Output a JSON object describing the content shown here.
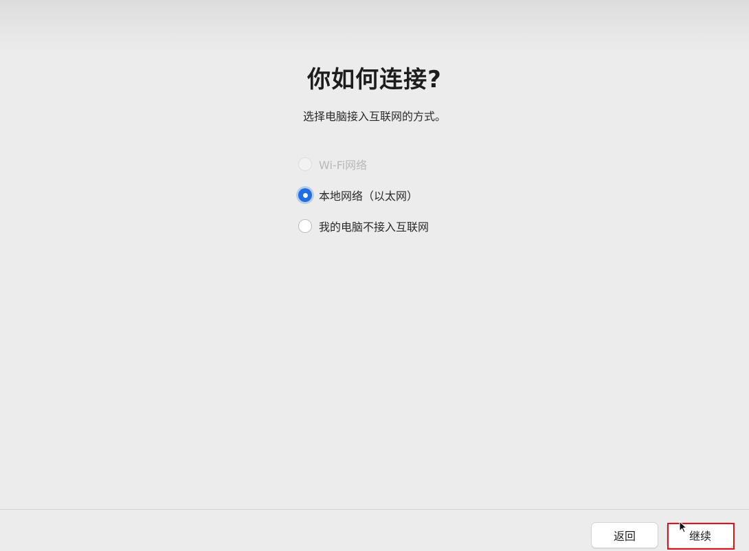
{
  "header": {
    "title": "你如何连接?",
    "subtitle": "选择电脑接入互联网的方式。"
  },
  "options": [
    {
      "label": "Wi-Fi网络",
      "state": "disabled"
    },
    {
      "label": "本地网络（以太网）",
      "state": "checked"
    },
    {
      "label": "我的电脑不接入互联网",
      "state": "unchecked"
    }
  ],
  "footer": {
    "back_label": "返回",
    "continue_label": "继续"
  },
  "colors": {
    "accent": "#1f6fe0",
    "highlight": "#d9141e",
    "background": "#ececec"
  },
  "icons": {
    "cursor": "arrow-cursor-icon"
  }
}
